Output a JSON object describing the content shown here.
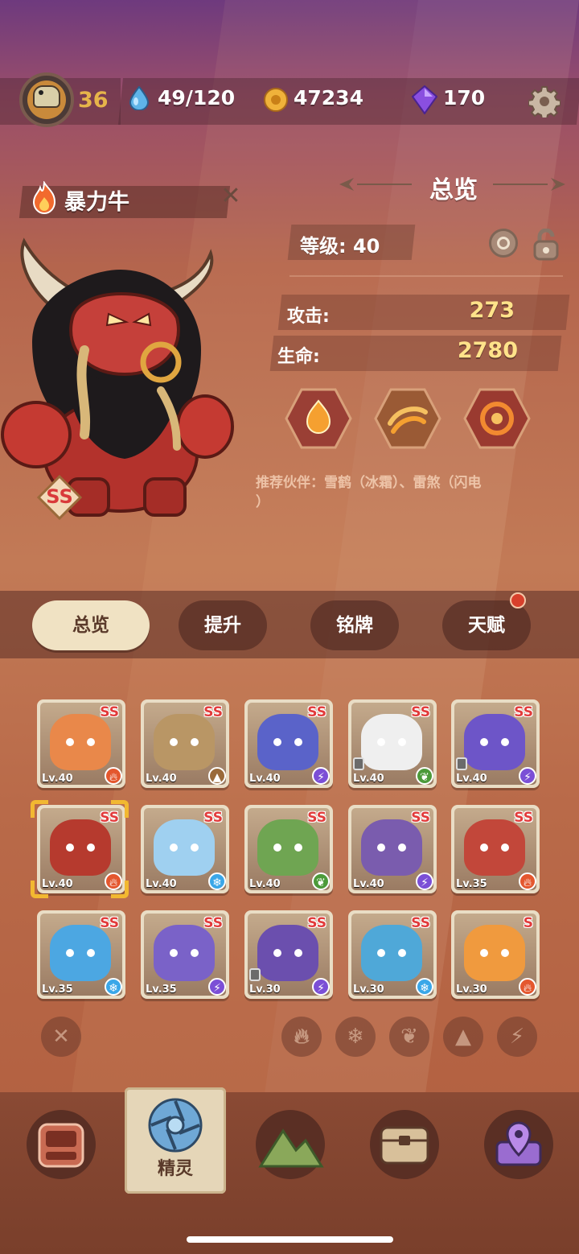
{
  "topbar": {
    "player_level": "36",
    "energy": "49/120",
    "coins": "47234",
    "gems": "170"
  },
  "pet": {
    "name": "暴力牛",
    "rarity": "SS",
    "element": "fire"
  },
  "overview": {
    "title": "总览",
    "level_text": "等级: 40",
    "attack_label": "攻击:",
    "attack_value": "273",
    "hp_label": "生命:",
    "hp_value": "2780",
    "recommend_line1": "推荐伙伴：雪鹤（冰霜）、雷煞（闪电",
    "recommend_line2": "）"
  },
  "tabs": [
    {
      "label": "总览",
      "active": true
    },
    {
      "label": "提升",
      "active": false
    },
    {
      "label": "铭牌",
      "active": false
    },
    {
      "label": "天赋",
      "active": false,
      "badge": true
    }
  ],
  "cards": [
    {
      "level": "Lv.40",
      "rarity": "SS",
      "element": "fire",
      "color": "#e9884a",
      "locked": false
    },
    {
      "level": "Lv.40",
      "rarity": "SS",
      "element": "earth",
      "color": "#b99665",
      "locked": false
    },
    {
      "level": "Lv.40",
      "rarity": "SS",
      "element": "lightning",
      "color": "#5a63c9",
      "locked": false
    },
    {
      "level": "Lv.40",
      "rarity": "SS",
      "element": "leaf",
      "color": "#efefef",
      "locked": true
    },
    {
      "level": "Lv.40",
      "rarity": "SS",
      "element": "lightning",
      "color": "#6d55c8",
      "locked": true
    },
    {
      "level": "Lv.40",
      "rarity": "SS",
      "element": "fire",
      "color": "#b63a2e",
      "locked": false
    },
    {
      "level": "Lv.40",
      "rarity": "SS",
      "element": "ice",
      "color": "#9fd0f0",
      "locked": false
    },
    {
      "level": "Lv.40",
      "rarity": "SS",
      "element": "leaf",
      "color": "#6fa552",
      "locked": false
    },
    {
      "level": "Lv.40",
      "rarity": "SS",
      "element": "lightning",
      "color": "#7a5cae",
      "locked": false
    },
    {
      "level": "Lv.35",
      "rarity": "SS",
      "element": "fire",
      "color": "#c2473a",
      "locked": false
    },
    {
      "level": "Lv.35",
      "rarity": "SS",
      "element": "ice",
      "color": "#4ca7e2",
      "locked": false
    },
    {
      "level": "Lv.35",
      "rarity": "SS",
      "element": "lightning",
      "color": "#7a62c8",
      "locked": false
    },
    {
      "level": "Lv.30",
      "rarity": "SS",
      "element": "lightning",
      "color": "#6b4fae",
      "locked": true
    },
    {
      "level": "Lv.30",
      "rarity": "SS",
      "element": "ice",
      "color": "#4fa8d8",
      "locked": false
    },
    {
      "level": "Lv.30",
      "rarity": "S",
      "element": "fire",
      "color": "#f09a3e",
      "locked": false
    }
  ],
  "bottom_nav": {
    "active_label": "精灵"
  },
  "colors": {
    "fire": "#e4572e",
    "ice": "#3aa7e8",
    "leaf": "#4c9a3a",
    "lightning": "#7b4fd6",
    "earth": "#9a6a3a"
  }
}
